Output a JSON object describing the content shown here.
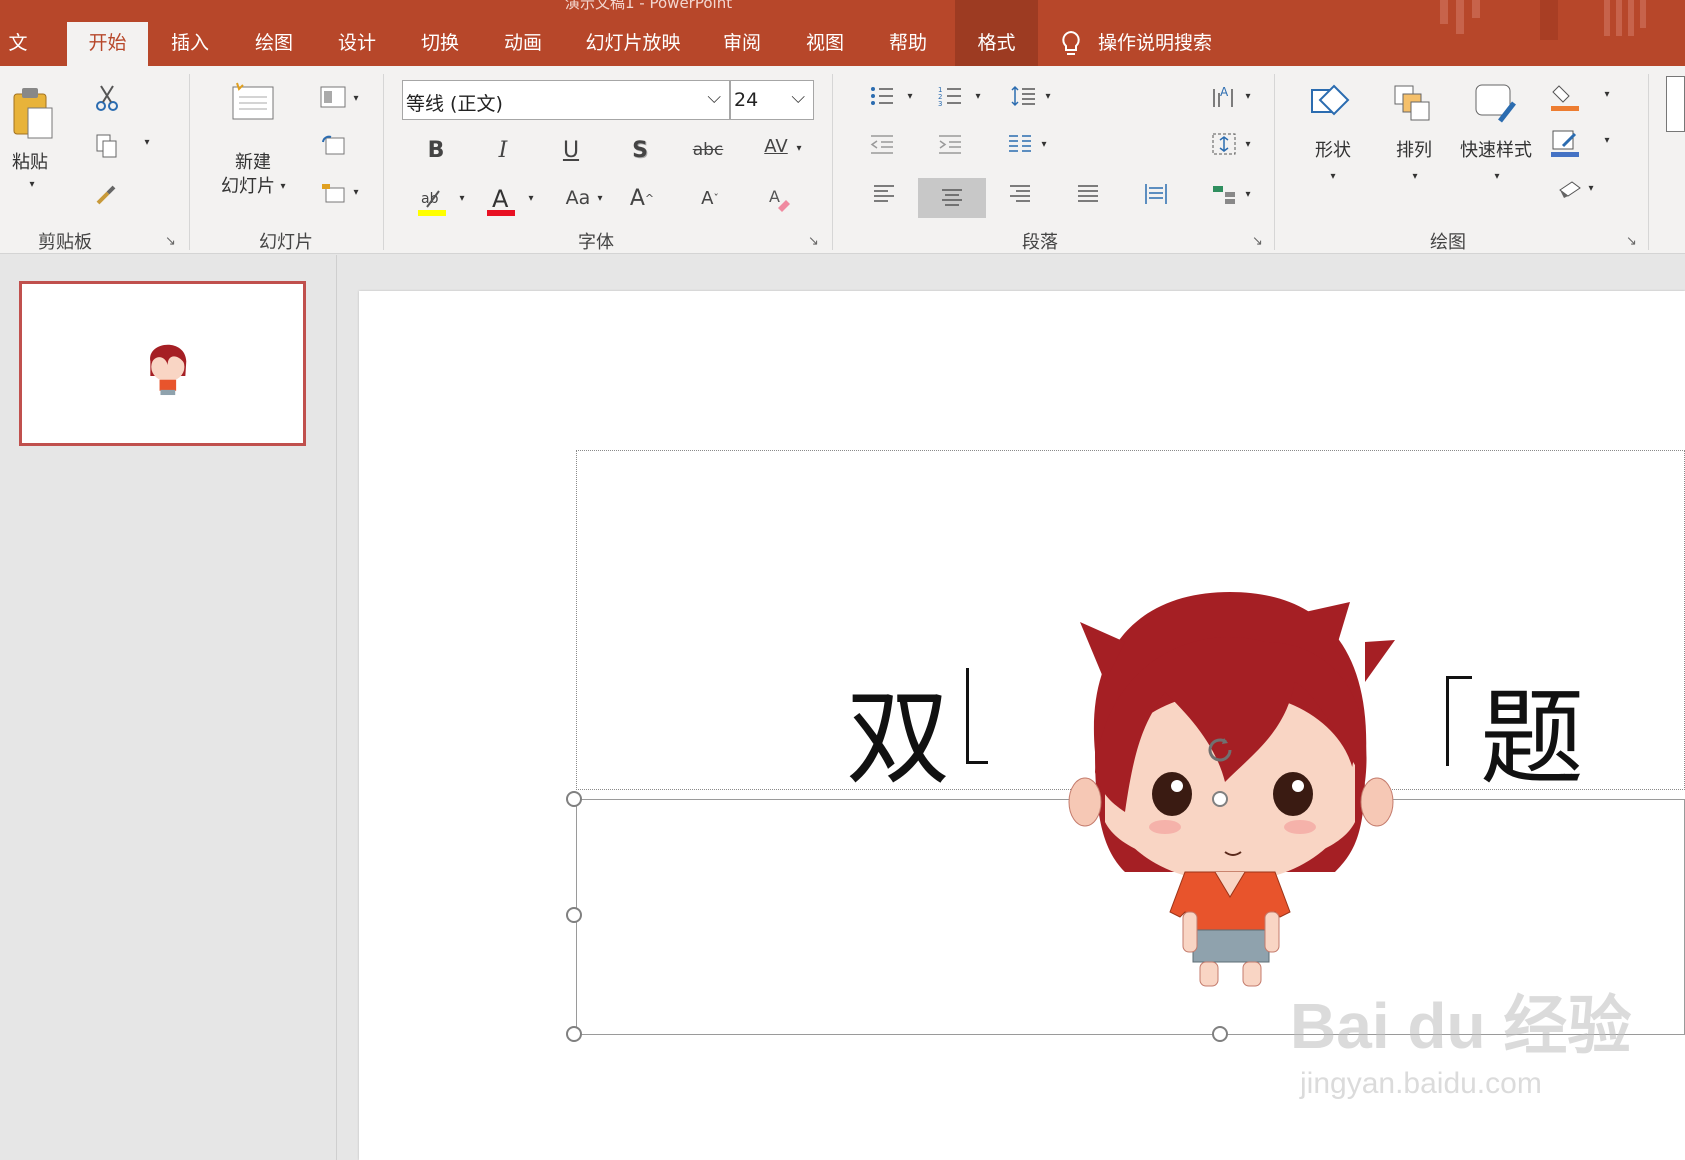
{
  "window": {
    "title": "演示文稿1 - PowerPoint"
  },
  "tabs": [
    {
      "label": "文件"
    },
    {
      "label": "开始"
    },
    {
      "label": "插入"
    },
    {
      "label": "绘图"
    },
    {
      "label": "设计"
    },
    {
      "label": "切换"
    },
    {
      "label": "动画"
    },
    {
      "label": "幻灯片放映"
    },
    {
      "label": "审阅"
    },
    {
      "label": "视图"
    },
    {
      "label": "帮助"
    },
    {
      "label": "格式"
    }
  ],
  "active_tab": "开始",
  "search": {
    "label": "操作说明搜索"
  },
  "ribbon": {
    "clipboard": {
      "label": "剪贴板",
      "paste": "粘贴"
    },
    "slides": {
      "label": "幻灯片",
      "new_slide_line1": "新建",
      "new_slide_line2": "幻灯片"
    },
    "font": {
      "label": "字体",
      "font_name": "等线 (正文)",
      "font_size": "24",
      "bold": "B",
      "italic": "I",
      "underline": "U",
      "shadow": "S",
      "strike": "abc",
      "spacing": "AV",
      "case": "Aa",
      "grow": "A",
      "shrink": "A"
    },
    "paragraph": {
      "label": "段落"
    },
    "drawing": {
      "label": "绘图",
      "shapes": "形状",
      "arrange": "排列",
      "quick_styles": "快速样式"
    }
  },
  "slide": {
    "title_visible_left": "双",
    "title_visible_right": "题"
  },
  "watermark": {
    "line1": "Bai du 经验",
    "line2": "jingyan.baidu.com"
  },
  "colors": {
    "accent": "#b7472a",
    "highlight_yellow": "#ffff00",
    "font_red": "#e81123",
    "thumb_border": "#c0504d"
  }
}
